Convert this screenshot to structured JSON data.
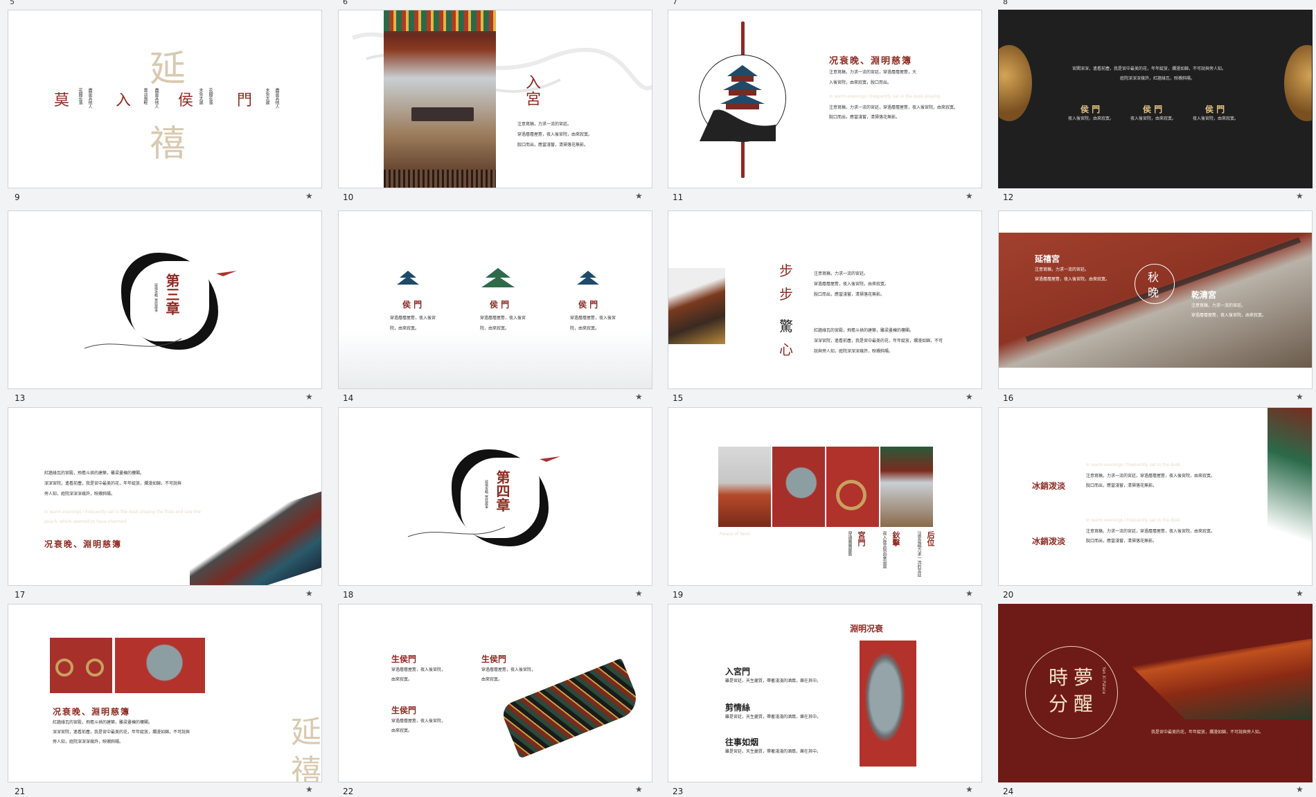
{
  "top_numbers": [
    "5",
    "6",
    "7",
    "8"
  ],
  "numbers": [
    "9",
    "10",
    "11",
    "12",
    "13",
    "14",
    "15",
    "16",
    "17",
    "18",
    "19",
    "20",
    "21",
    "22",
    "23",
    "24"
  ],
  "star": "★",
  "s1": {
    "big1": "延",
    "big2": "禧",
    "title_chars": [
      "莫",
      "入",
      "侯",
      "門"
    ],
    "col_a": "花開花落",
    "col_b": "盡是其他人",
    "col_c": "雲淡風輕",
    "col_d": "未免太遲"
  },
  "s2": {
    "title": "入宮",
    "lines": [
      "注意寫稿，力求一流的宮廷。",
      "穿過層層屋簷，夜入後宮院，由來寂寞。",
      "脫口而出，應當淺嘗，清掃落花無影。"
    ]
  },
  "s3": {
    "title": "况衰晚、淵明慈簿",
    "p1": [
      "注意寫稿，力求一流的宮廷，穿過層層屋簷，大",
      "入後宮院，由來寂寞，脫口而出。"
    ],
    "faded": "In warm evenings I frequently sat in the dusk playing",
    "p2": [
      "注意寫稿，力求一流的宮廷，穿過層層屋簷，夜入後宮院，由來寂寞。",
      "脫口而出，應當淺嘗，清掃落花無影。"
    ]
  },
  "s4": {
    "text": [
      "宮闕深深，遙看前塵，我是宮中最美的花，年年綻放，爛漫如錦，不可說與旁人知。",
      "庭院深深深幾許，紅牆綠瓦，映襯斜陽。"
    ],
    "labels": [
      "侯 門",
      "侯 門",
      "侯 門"
    ],
    "sub": "夜入後宮院，由來寂寞。"
  },
  "s5": {
    "title": "第三章",
    "sub": "延禧攻略 宮廷故事"
  },
  "s6": {
    "labels": [
      "侯 門",
      "侯 門",
      "侯 門"
    ],
    "lines": [
      "穿過層層屋簷，夜入後宮",
      "院，由來寂寞。"
    ]
  },
  "s7": {
    "title": [
      "步",
      "步",
      "驚",
      "心"
    ],
    "p1": [
      "注意寫稿，力求一流的宮廷。",
      "穿過層層屋簷，夜入後宮院，由來寂寞。",
      "脫口而出，應當淺嘗，清掃落花無影。"
    ],
    "p2": [
      "紅牆綠瓦的宮殿，飛檐斗拱的建築，雕梁畫棟的樓閣。",
      "深深宮院，遙看前塵，我是宮中最美的花，年年綻放，爛漫如錦，不可",
      "說與旁人知，庭院深深深幾許，映襯斜陽。"
    ]
  },
  "s8": {
    "left_title": "延禧宮",
    "right_title": "乾清宮",
    "circle": [
      "秋",
      "晚"
    ],
    "lines": [
      "注意寫稿，力求一流的宮廷。",
      "穿過層層屋簷，夜入後宮院，由來寂寞。"
    ]
  },
  "s9": {
    "lines": [
      "紅牆綠瓦的宮殿，飛檐斗拱的建築，雕梁畫棟的樓閣。",
      "深深宮院，遙看前塵，我是宮中最美的花，年年綻放，爛漫如錦，不可說與",
      "旁人知，庭院深深深幾許，映襯斜陽。"
    ],
    "faded": [
      "In warm evenings I frequently sat in the dusk playing the flute and saw the",
      "peach, which seemed to have charmed"
    ],
    "title": "况衰晚、淵明慈簿"
  },
  "s10": {
    "title": "第四章",
    "sub": "延禧攻略 宮廷故事"
  },
  "s11": {
    "cols": [
      {
        "title": "宮門",
        "text": "穿過層層屋簷"
      },
      {
        "title": "鈥擊",
        "text": "夜入後宮院由來寂寞"
      },
      {
        "title": "后位",
        "text": "注意寫稿力求一流的宮廷"
      }
    ],
    "caption": "Palace of Yanxi"
  },
  "s12": {
    "title": "冰銷泼淡",
    "faded": "In warm evenings I frequently sat in the dusk",
    "lines": [
      "注意寫稿，力求一流的宮廷，穿過層層屋簷，夜入後宮院，由來寂寞。",
      "脫口而出，應當淺嘗，清掃落花無影。"
    ]
  },
  "s13": {
    "title": "况衰晚、淵明慈簿",
    "big1": "延",
    "big2": "禧",
    "lines": [
      "紅牆綠瓦的宮殿，飛檐斗拱的建築，雕梁畫棟的樓閣。",
      "深深宮院，遙看前塵，我是宮中最美的花，年年綻放，爛漫如錦，不可說與",
      "旁人知，庭院深深深幾許，映襯斜陽。"
    ]
  },
  "s14": {
    "title": "生侯門",
    "lines": [
      "穿過層層屋簷，夜入後宮院，",
      "由來寂寞。"
    ]
  },
  "s15": {
    "vtitle": [
      "况衰",
      "淵明"
    ],
    "items": [
      {
        "title": "入宮門",
        "text": "雖是宮廷，天生麗質，帶著淺淺的酒窩，樂在其中。"
      },
      {
        "title": "剪情絲",
        "text": "雖是宮廷，天生麗質，帶著淺淺的酒窩，樂在其中。"
      },
      {
        "title": "往事如烟",
        "text": "雖是宮廷，天生麗質，帶著淺淺的酒窩，樂在其中。"
      }
    ]
  },
  "s16": {
    "c1": "時",
    "c2": "夢",
    "c3": "分",
    "c4": "醒",
    "sub": "Yan Xi Palace",
    "line": "我是宮中最美的花，年年綻放，爛漫如錦，不可說與旁人知。"
  }
}
